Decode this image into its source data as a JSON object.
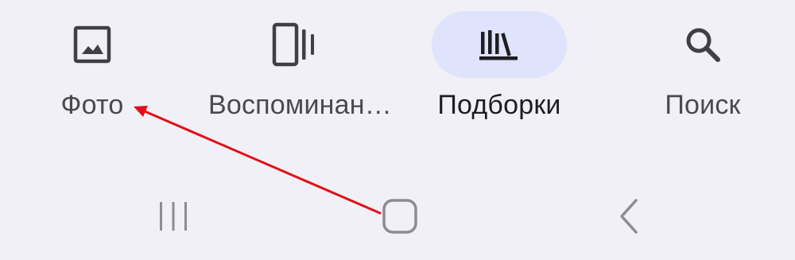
{
  "bottom_nav": {
    "items": [
      {
        "label": "Фото",
        "icon": "photo-icon",
        "active": false
      },
      {
        "label": "Воспоминан…",
        "icon": "memories-icon",
        "active": false
      },
      {
        "label": "Подборки",
        "icon": "collections-icon",
        "active": true
      },
      {
        "label": "Поиск",
        "icon": "search-icon",
        "active": false
      }
    ],
    "active_pill_color": "#dfe3fb",
    "icon_color": "#3f3f44"
  },
  "system_nav": {
    "buttons": [
      {
        "icon": "recents-icon"
      },
      {
        "icon": "home-icon"
      },
      {
        "icon": "back-icon"
      }
    ]
  },
  "annotation": {
    "color": "#e0101a",
    "from": "home-button",
    "to": "nav-label-photo"
  }
}
